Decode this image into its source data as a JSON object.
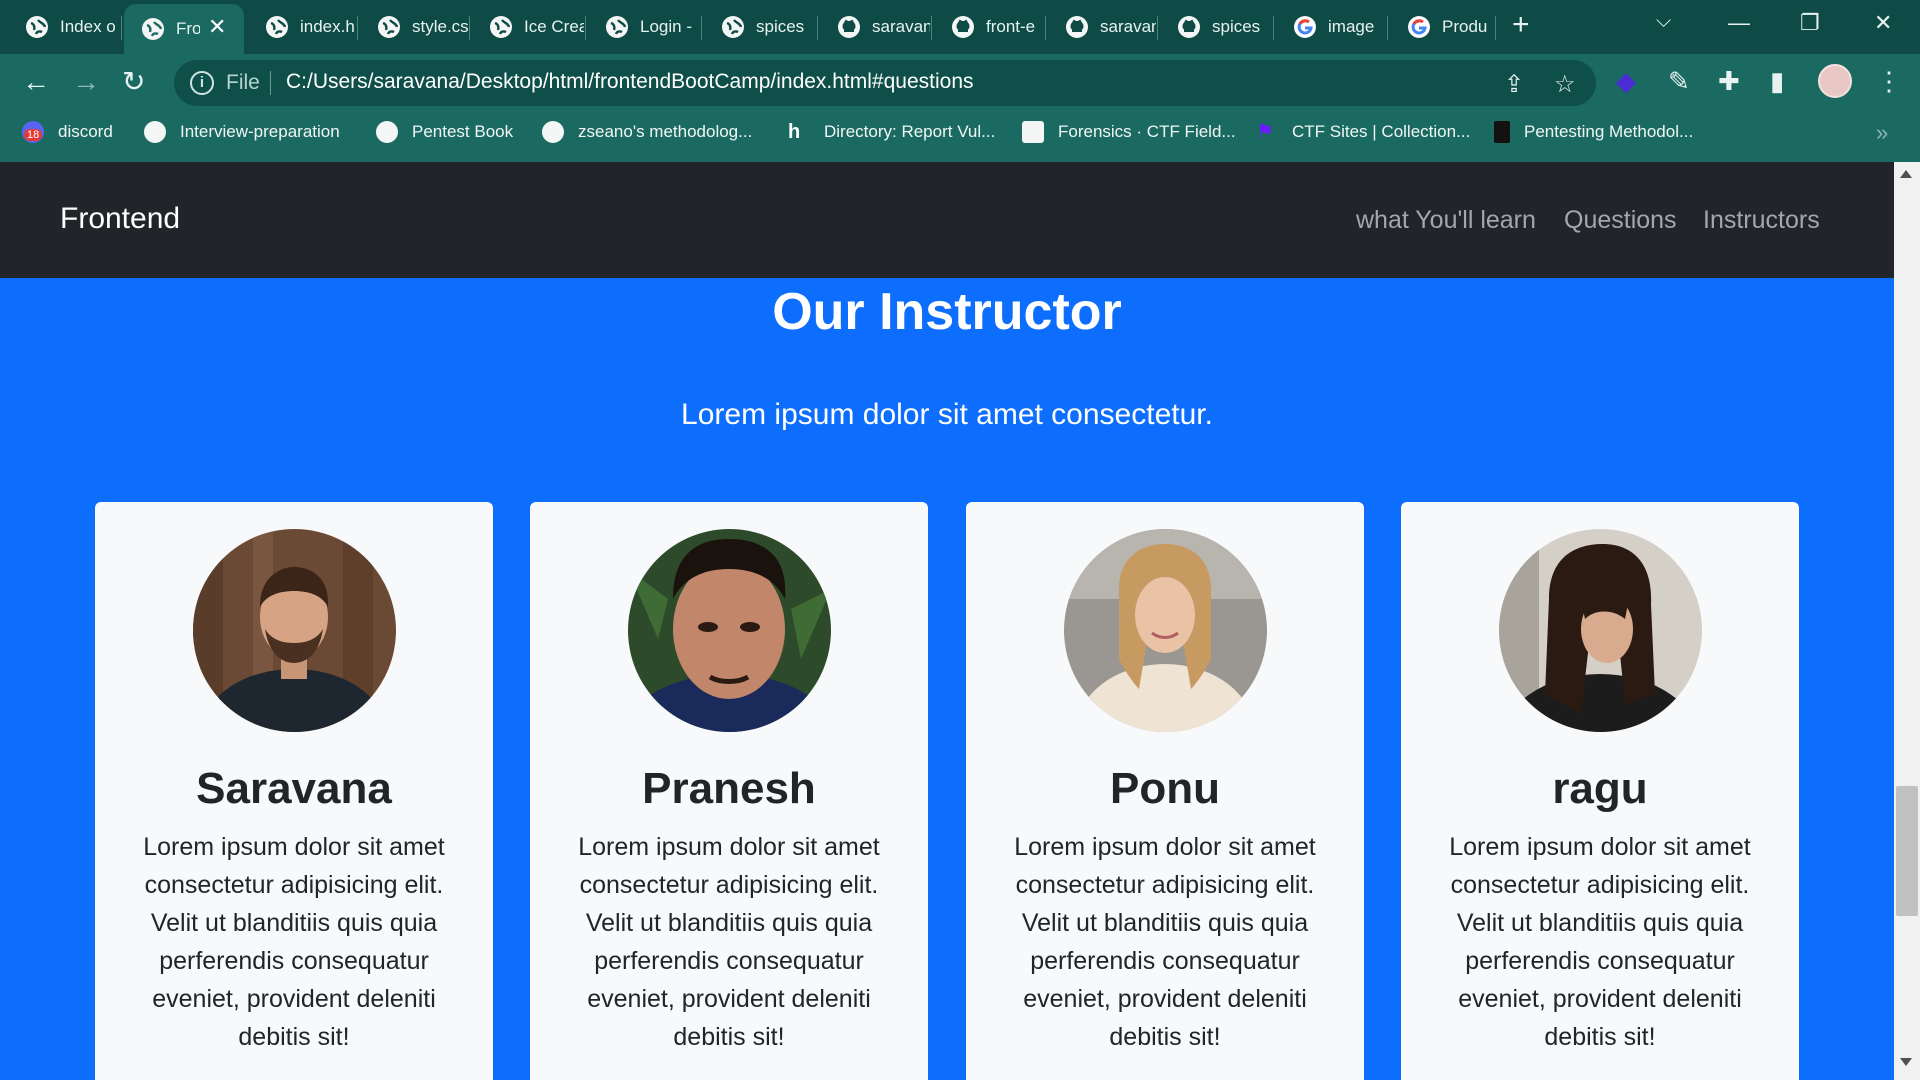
{
  "browser": {
    "tabs": [
      {
        "title": "Index o"
      },
      {
        "title": "Fro"
      },
      {
        "title": "index.h"
      },
      {
        "title": "style.cs"
      },
      {
        "title": "Ice Crea"
      },
      {
        "title": "Login -"
      },
      {
        "title": "spices"
      },
      {
        "title": "saravan"
      },
      {
        "title": "front-e"
      },
      {
        "title": "saravan"
      },
      {
        "title": "spices"
      },
      {
        "title": "image"
      },
      {
        "title": "Produ"
      }
    ],
    "omnibox": {
      "scheme_label": "File",
      "url": "C:/Users/saravana/Desktop/html/frontendBootCamp/index.html#questions"
    },
    "bookmarks": [
      {
        "label": "discord",
        "badge": "18"
      },
      {
        "label": "Interview-preparation"
      },
      {
        "label": "Pentest Book"
      },
      {
        "label": "zseano's methodolog..."
      },
      {
        "label": "Directory: Report Vul..."
      },
      {
        "label": "Forensics · CTF Field..."
      },
      {
        "label": "CTF Sites | Collection..."
      },
      {
        "label": "Pentesting Methodol..."
      }
    ]
  },
  "site": {
    "brand": "Frontend",
    "nav": [
      "what You'll learn",
      "Questions",
      "Instructors"
    ],
    "section_title": "Our Instructor",
    "section_lead": "Lorem ipsum dolor sit amet consectetur.",
    "instructors": [
      {
        "name": "Saravana",
        "bio": "Lorem ipsum dolor sit amet consectetur adipisicing elit. Velit ut blanditiis quis quia perferendis consequatur eveniet, provident deleniti debitis sit!"
      },
      {
        "name": "Pranesh",
        "bio": "Lorem ipsum dolor sit amet consectetur adipisicing elit. Velit ut blanditiis quis quia perferendis consequatur eveniet, provident deleniti debitis sit!"
      },
      {
        "name": "Ponu",
        "bio": "Lorem ipsum dolor sit amet consectetur adipisicing elit. Velit ut blanditiis quis quia perferendis consequatur eveniet, provident deleniti debitis sit!"
      },
      {
        "name": "ragu",
        "bio": "Lorem ipsum dolor sit amet consectetur adipisicing elit. Velit ut blanditiis quis quia perferendis consequatur eveniet, provident deleniti debitis sit!"
      }
    ]
  },
  "colors": {
    "browser_frame": "#0e4b46",
    "browser_toolbar": "#1b6a62",
    "page_section": "#0d6efd",
    "site_nav": "#212529",
    "card": "#f8f9fa"
  }
}
